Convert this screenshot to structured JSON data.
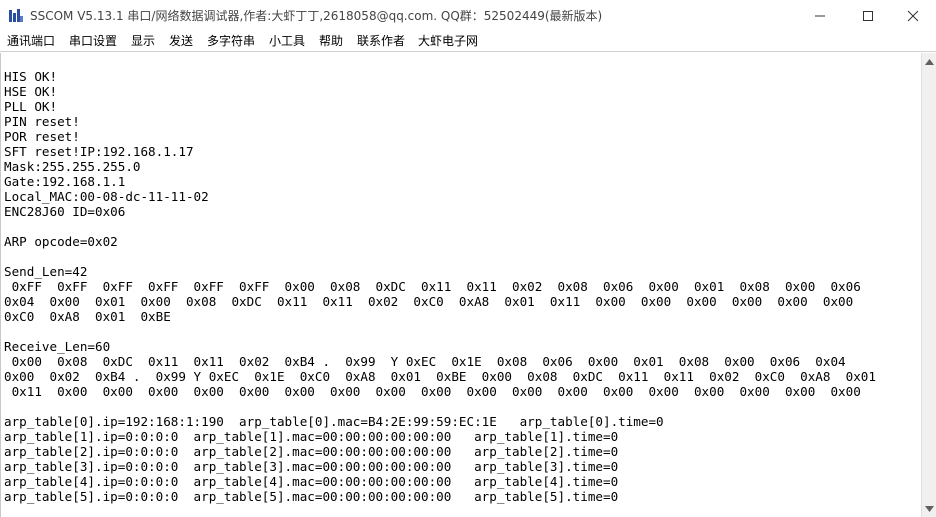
{
  "window": {
    "title": "SSCOM V5.13.1 串口/网络数据调试器,作者:大虾丁丁,2618058@qq.com. QQ群：52502449(最新版本)"
  },
  "menu": {
    "items": [
      "通讯端口",
      "串口设置",
      "显示",
      "发送",
      "多字符串",
      "小工具",
      "帮助",
      "联系作者",
      "大虾电子网"
    ]
  },
  "output": {
    "lines": [
      "HIS OK!",
      "HSE OK!",
      "PLL OK!",
      "PIN reset!",
      "POR reset!",
      "SFT reset!IP:192.168.1.17",
      "Mask:255.255.255.0",
      "Gate:192.168.1.1",
      "Local_MAC:00-08-dc-11-11-02",
      "ENC28J60 ID=0x06",
      "",
      "ARP opcode=0x02",
      "",
      "Send_Len=42",
      " 0xFF  0xFF  0xFF  0xFF  0xFF  0xFF  0x00  0x08  0xDC  0x11  0x11  0x02  0x08  0x06  0x00  0x01  0x08  0x00  0x06",
      "0x04  0x00  0x01  0x00  0x08  0xDC  0x11  0x11  0x02  0xC0  0xA8  0x01  0x11  0x00  0x00  0x00  0x00  0x00  0x00",
      "0xC0  0xA8  0x01  0xBE",
      "",
      "Receive_Len=60",
      " 0x00  0x08  0xDC  0x11  0x11  0x02  0xB4 .  0x99  Y 0xEC  0x1E  0x08  0x06  0x00  0x01  0x08  0x00  0x06  0x04",
      "0x00  0x02  0xB4 .  0x99 Y 0xEC  0x1E  0xC0  0xA8  0x01  0xBE  0x00  0x08  0xDC  0x11  0x11  0x02  0xC0  0xA8  0x01",
      " 0x11  0x00  0x00  0x00  0x00  0x00  0x00  0x00  0x00  0x00  0x00  0x00  0x00  0x00  0x00  0x00  0x00  0x00  0x00",
      "",
      "arp_table[0].ip=192:168:1:190  arp_table[0].mac=B4:2E:99:59:EC:1E   arp_table[0].time=0",
      "arp_table[1].ip=0:0:0:0  arp_table[1].mac=00:00:00:00:00:00   arp_table[1].time=0",
      "arp_table[2].ip=0:0:0:0  arp_table[2].mac=00:00:00:00:00:00   arp_table[2].time=0",
      "arp_table[3].ip=0:0:0:0  arp_table[3].mac=00:00:00:00:00:00   arp_table[3].time=0",
      "arp_table[4].ip=0:0:0:0  arp_table[4].mac=00:00:00:00:00:00   arp_table[4].time=0",
      "arp_table[5].ip=0:0:0:0  arp_table[5].mac=00:00:00:00:00:00   arp_table[5].time=0"
    ]
  },
  "icons": {
    "app": "sscom-app-icon",
    "minimize": "minimize-icon",
    "maximize": "maximize-icon",
    "close": "close-icon"
  },
  "colors": {
    "title_text": "#444444",
    "app_icon": "#2b4fa0",
    "output_text": "#000000"
  }
}
